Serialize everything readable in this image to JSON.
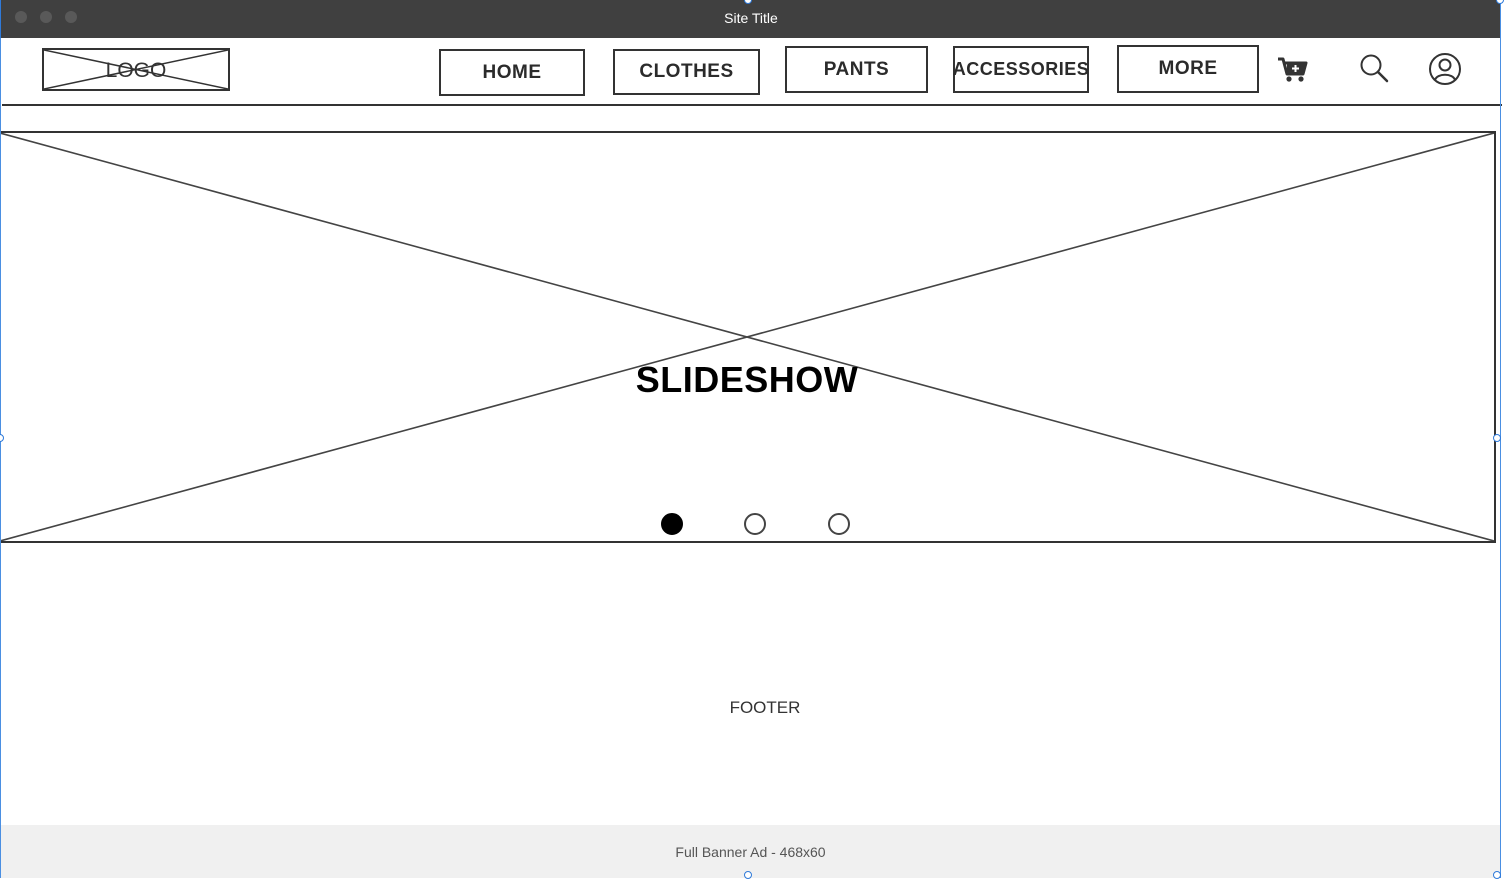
{
  "window": {
    "title": "Site Title"
  },
  "header": {
    "logo_text": "LOGO",
    "nav": [
      {
        "label": "HOME"
      },
      {
        "label": "CLOTHES"
      },
      {
        "label": "PANTS"
      },
      {
        "label": "ACCESSORIES"
      },
      {
        "label": "MORE"
      }
    ],
    "icons": [
      "cart-plus-icon",
      "search-icon",
      "user-icon"
    ]
  },
  "slideshow": {
    "label": "SLIDESHOW",
    "total_slides": 3,
    "active_slide": 1
  },
  "footer": {
    "label": "FOOTER"
  },
  "ad": {
    "label": "Full Banner Ad - 468x60"
  },
  "colors": {
    "titlebar": "#404040",
    "wireframe_stroke": "#333333",
    "ad_background": "#f0f0f0",
    "selection": "#2f7ad9"
  }
}
